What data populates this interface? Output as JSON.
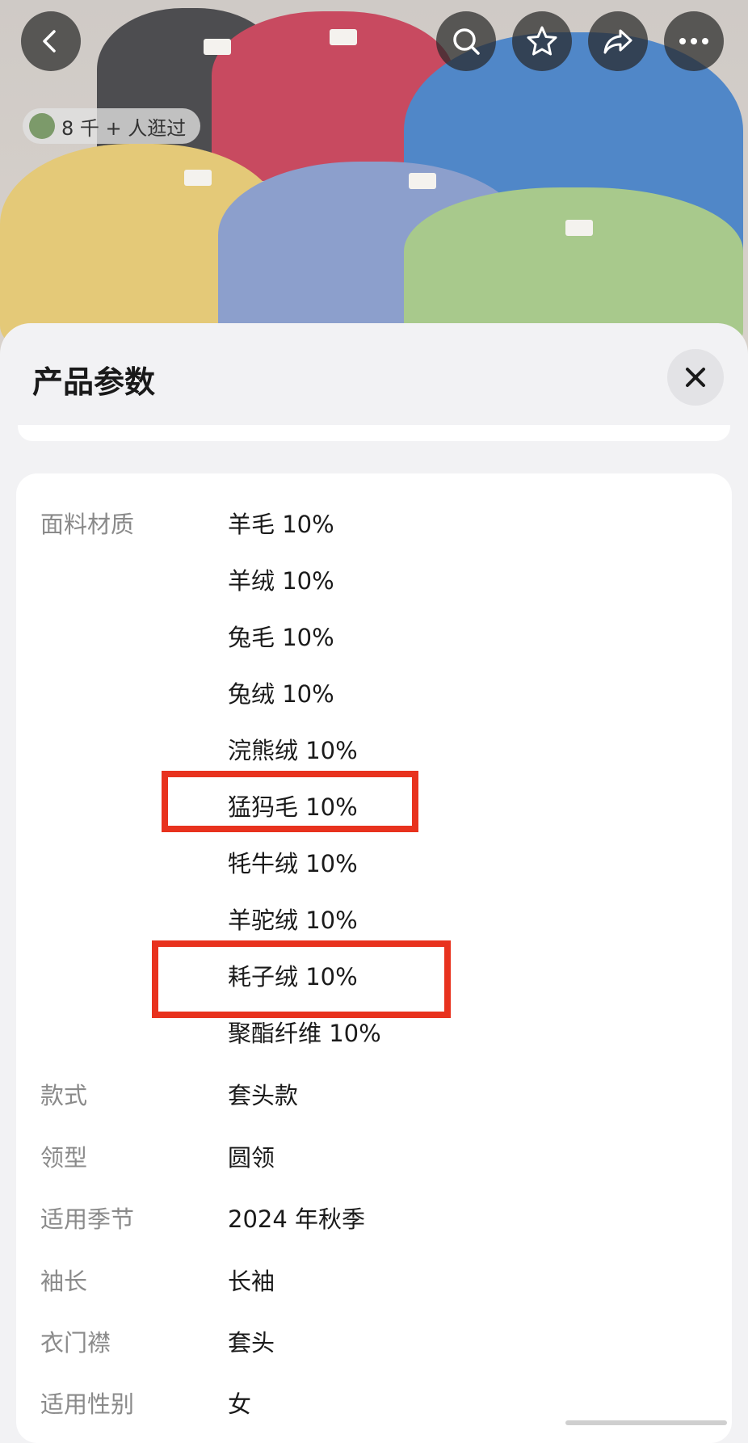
{
  "header": {
    "views_badge": "8 千 + 人逛过",
    "icons": [
      "back-icon",
      "search-icon",
      "star-icon",
      "share-icon",
      "more-icon"
    ]
  },
  "sheet": {
    "title": "产品参数",
    "fabric": {
      "label": "面料材质",
      "values": [
        "羊毛 10%",
        "羊绒 10%",
        "兔毛 10%",
        "兔绒 10%",
        "浣熊绒 10%",
        "猛犸毛 10%",
        "牦牛绒 10%",
        "羊驼绒 10%",
        "耗子绒 10%",
        "聚酯纤维 10%"
      ]
    },
    "rows": [
      {
        "label": "款式",
        "value": "套头款"
      },
      {
        "label": "领型",
        "value": "圆领"
      },
      {
        "label": "适用季节",
        "value": "2024 年秋季"
      },
      {
        "label": "袖长",
        "value": "长袖"
      },
      {
        "label": "衣门襟",
        "value": "套头"
      },
      {
        "label": "适用性别",
        "value": "女"
      }
    ]
  },
  "colors": {
    "highlight": "#e8321e",
    "sweaters": [
      "#4b4b4d",
      "#c9485f",
      "#4f86c9",
      "#e3c875",
      "#8b9fca",
      "#a9c98d"
    ]
  }
}
